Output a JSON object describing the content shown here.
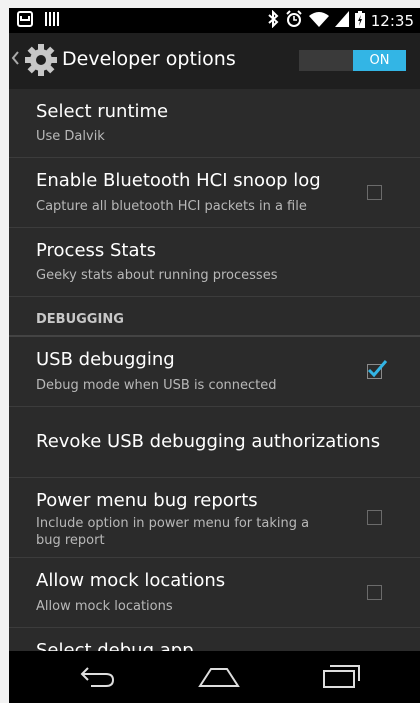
{
  "status_bar": {
    "time": "12:35",
    "icons": [
      "notification-icon",
      "barcode-icon",
      "bluetooth-icon",
      "alarm-icon",
      "wifi-icon",
      "signal-icon",
      "battery-icon"
    ]
  },
  "action_bar": {
    "title": "Developer options",
    "toggle_label": "ON",
    "icon": "settings-gear-icon"
  },
  "settings": {
    "select_runtime": {
      "title": "Select runtime",
      "summary": "Use Dalvik"
    },
    "bt_hci_log": {
      "title": "Enable Bluetooth HCI snoop log",
      "summary": "Capture all bluetooth HCI packets in a file",
      "checked": false
    },
    "process_stats": {
      "title": "Process Stats",
      "summary": "Geeky stats about running processes"
    },
    "section_debugging": "DEBUGGING",
    "usb_debugging": {
      "title": "USB debugging",
      "summary": "Debug mode when USB is connected",
      "checked": true
    },
    "revoke_usb": {
      "title": "Revoke USB debugging authorizations"
    },
    "power_menu_bug": {
      "title": "Power menu bug reports",
      "summary_line1": "Include option in power menu for taking a",
      "summary_line2": "bug report",
      "checked": false
    },
    "mock_locations": {
      "title": "Allow mock locations",
      "summary": "Allow mock locations",
      "checked": false
    },
    "select_debug_app": {
      "title": "Select debug app"
    }
  },
  "colors": {
    "accent": "#33b5e5",
    "background": "#2b2b2b",
    "action_bar": "#1f1f1f",
    "divider": "#3c3c3c"
  },
  "nav_bar": {
    "icons": [
      "back-icon",
      "home-icon",
      "recent-apps-icon"
    ]
  }
}
